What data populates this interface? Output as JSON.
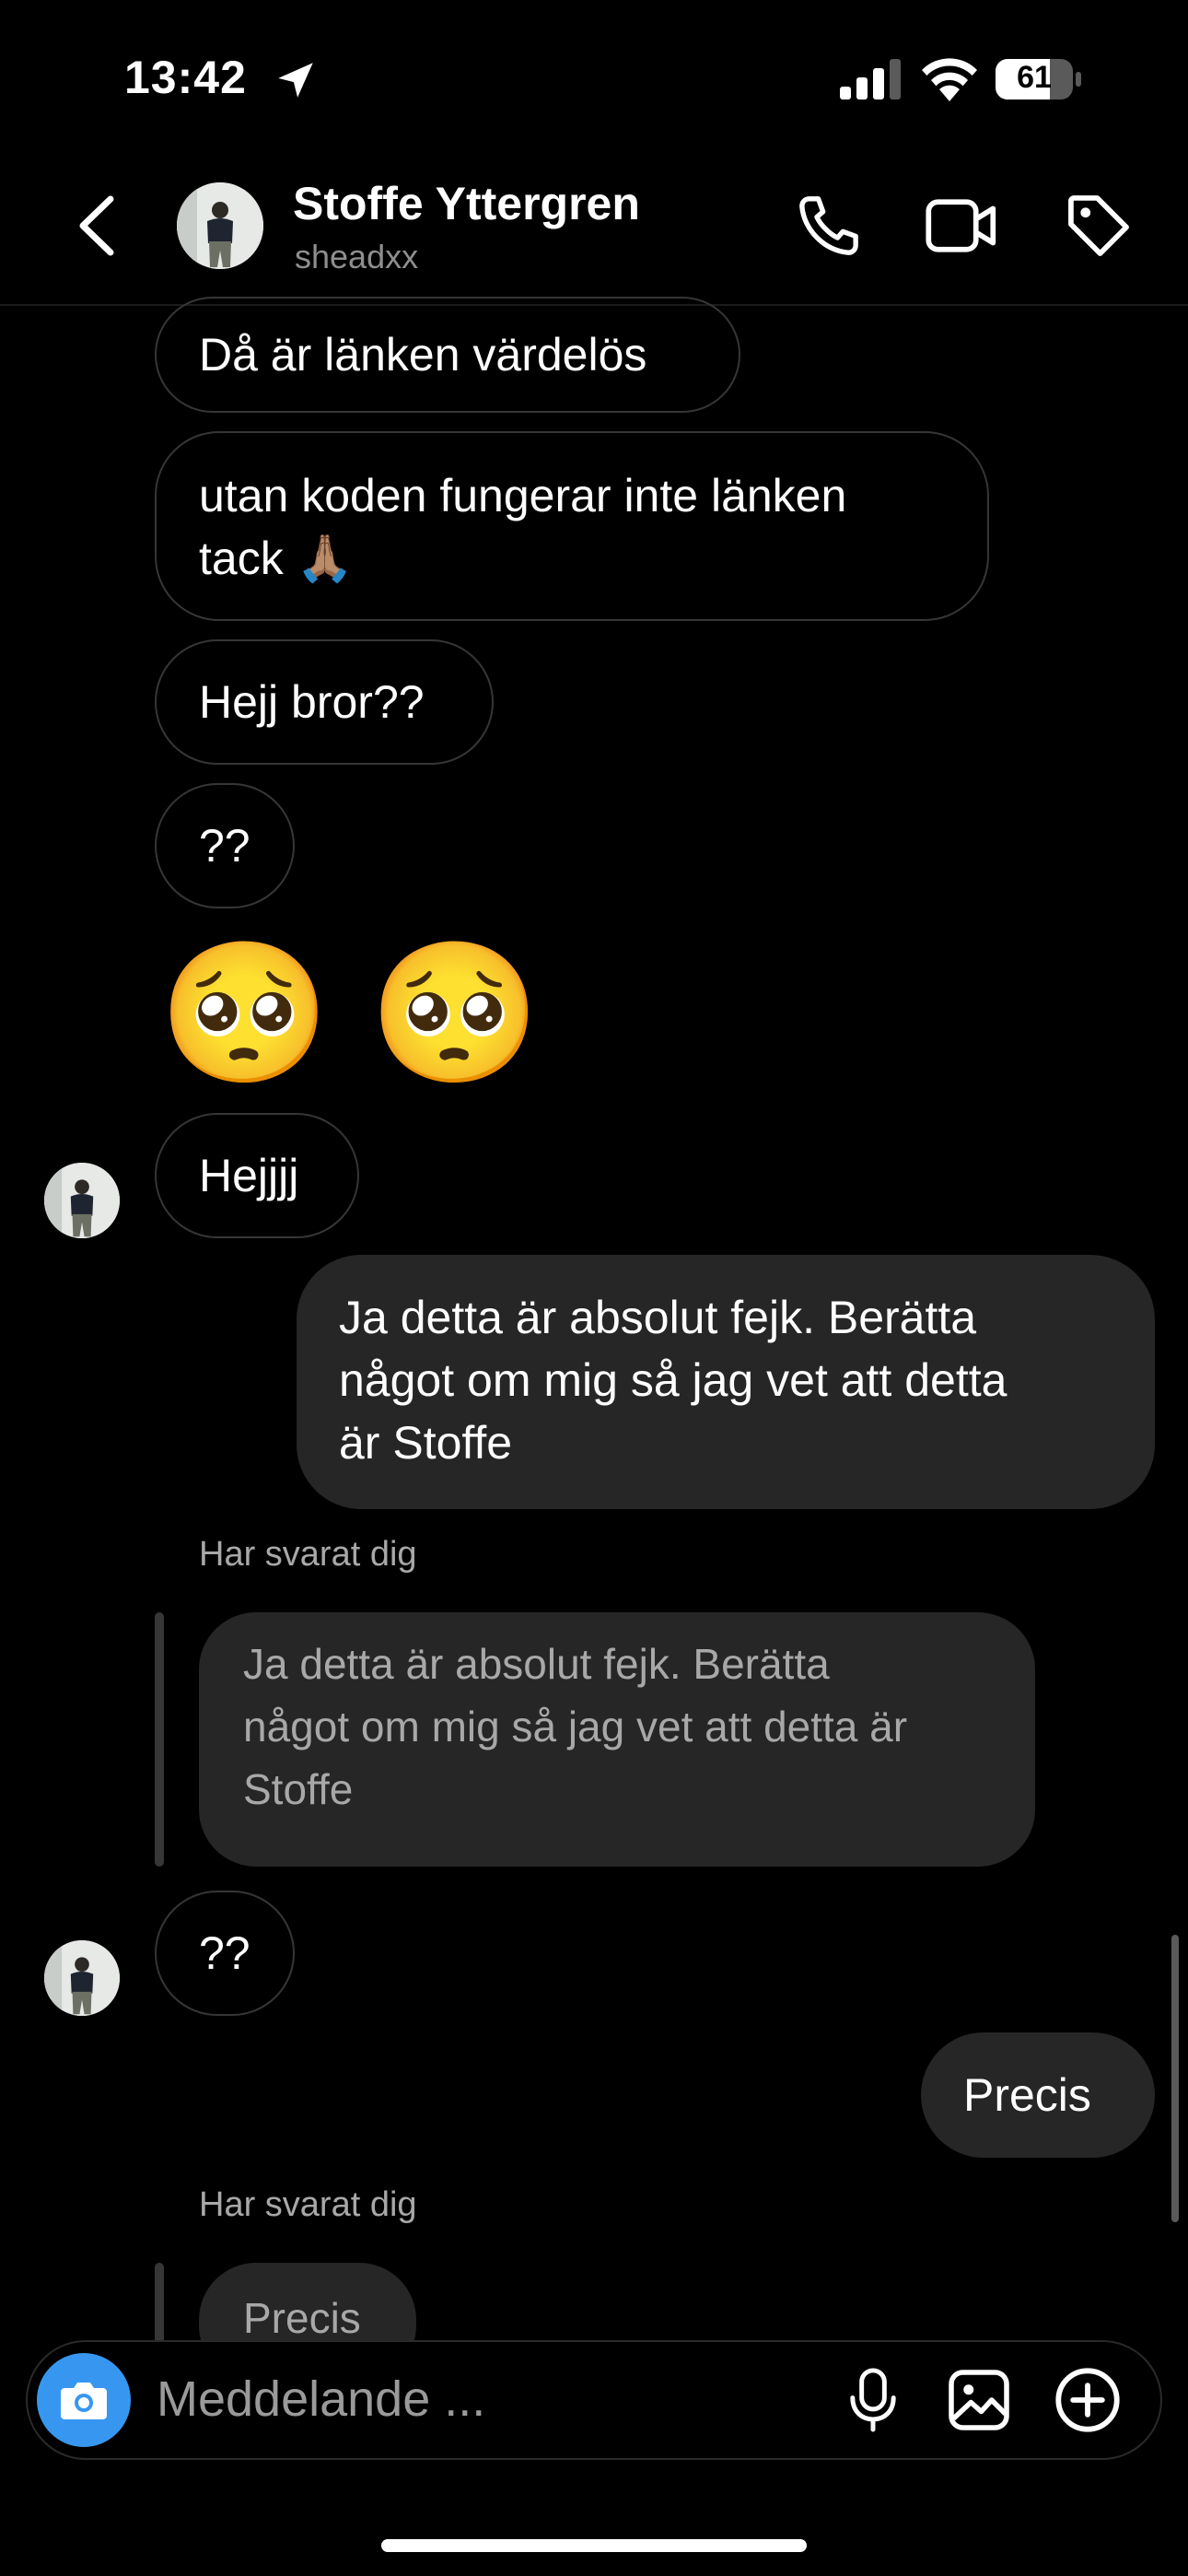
{
  "status_bar": {
    "time": "13:42",
    "battery": "61"
  },
  "header": {
    "name": "Stoffe Yttergren",
    "username": "sheadxx"
  },
  "messages": {
    "m1": "Då är länken värdelös",
    "m2_line1": "utan koden fungerar inte länken",
    "m2_line2": "tack 🙏🏽",
    "m3": "Hejj bror??",
    "m4": "??",
    "m5_emojis": "🥺 🥺",
    "m6": "Hejjjj",
    "sent1_line1": "Ja detta är absolut fejk. Berätta",
    "sent1_line2": "något om mig så jag vet att detta",
    "sent1_line3": "är Stoffe",
    "reply1_label": "Har svarat dig",
    "quote1_line1": "Ja detta är absolut fejk. Berätta",
    "quote1_line2": "något om mig så jag vet att detta är",
    "quote1_line3": "Stoffe",
    "m7": "??",
    "sent2": "Precis",
    "reply2_label": "Har svarat dig",
    "quote2": "Precis"
  },
  "composer": {
    "placeholder": "Meddelande ..."
  },
  "colors": {
    "background": "#000000",
    "sent_bubble": "#262626",
    "camera_button": "#3797f0"
  }
}
